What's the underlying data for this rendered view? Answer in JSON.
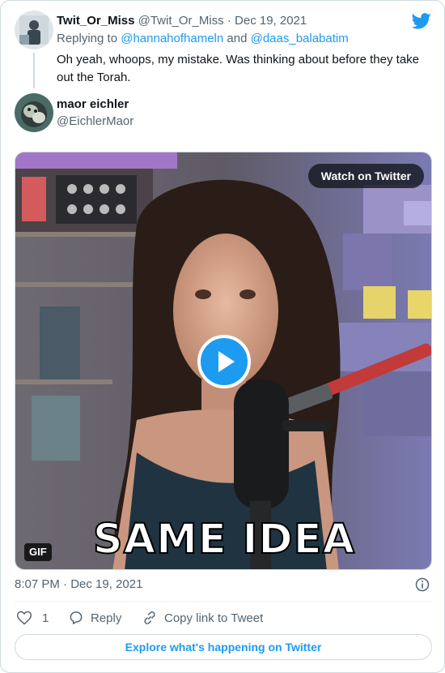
{
  "tweet_parent": {
    "display_name": "Twit_Or_Miss",
    "handle": "@Twit_Or_Miss",
    "separator": "·",
    "date": "Dec 19, 2021",
    "replying_prefix": "Replying to",
    "reply_to_1": "@hannahofhameln",
    "reply_and": "and",
    "reply_to_2": "@daas_balabatim",
    "text": "Oh yeah, whoops, my mistake. Was thinking about before they take out the Torah."
  },
  "tweet_main": {
    "display_name": "maor eichler",
    "handle": "@EichlerMaor",
    "media": {
      "watch_label": "Watch on Twitter",
      "badge": "GIF",
      "caption": "SAME IDEA"
    },
    "timestamp": "8:07 PM · Dec 19, 2021",
    "actions": {
      "like_count": "1",
      "reply_label": "Reply",
      "copy_label": "Copy link to Tweet"
    },
    "explore_label": "Explore what's happening on Twitter"
  },
  "icons": {
    "brand": "twitter-bird-icon",
    "info": "info-icon",
    "like": "heart-icon",
    "reply": "speech-bubble-icon",
    "copy": "link-icon",
    "play": "play-icon"
  },
  "colors": {
    "accent": "#1d9bf0",
    "text": "#0f1419",
    "secondary": "#536471",
    "border": "#cfd9de"
  }
}
